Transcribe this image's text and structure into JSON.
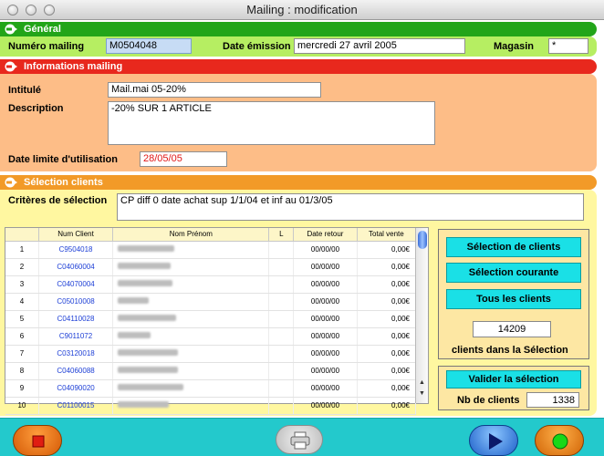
{
  "window": {
    "title": "Mailing : modification"
  },
  "general": {
    "header": "Général",
    "numero_label": "Numéro mailing",
    "numero_value": "M0504048",
    "date_label": "Date émission",
    "date_value": "mercredi 27 avril 2005",
    "magasin_label": "Magasin",
    "magasin_value": "*"
  },
  "info": {
    "header": "Informations mailing",
    "intitule_label": "Intitulé",
    "intitule_value": "Mail.mai 05-20%",
    "description_label": "Description",
    "description_value": "-20% SUR 1 ARTICLE",
    "date_limite_label": "Date limite d'utilisation",
    "date_limite_value": "28/05/05"
  },
  "selection": {
    "header": "Sélection clients",
    "criteres_label": "Critères de sélection",
    "criteres_value": "CP diff 0   date achat sup 1/1/04 et inf au 01/3/05"
  },
  "table": {
    "columns": [
      "",
      "Num Client",
      "Nom Prénom",
      "L",
      "Date retour",
      "Total vente"
    ],
    "rows": [
      {
        "n": "1",
        "client": "C9504018",
        "name_len": 62,
        "date": "00/00/00",
        "total": "0,00€"
      },
      {
        "n": "2",
        "client": "C04060004",
        "name_len": 58,
        "date": "00/00/00",
        "total": "0,00€"
      },
      {
        "n": "3",
        "client": "C04070004",
        "name_len": 60,
        "date": "00/00/00",
        "total": "0,00€"
      },
      {
        "n": "4",
        "client": "C05010008",
        "name_len": 34,
        "date": "00/00/00",
        "total": "0,00€"
      },
      {
        "n": "5",
        "client": "C04110028",
        "name_len": 64,
        "date": "00/00/00",
        "total": "0,00€"
      },
      {
        "n": "6",
        "client": "C9011072",
        "name_len": 36,
        "date": "00/00/00",
        "total": "0,00€"
      },
      {
        "n": "7",
        "client": "C03120018",
        "name_len": 66,
        "date": "00/00/00",
        "total": "0,00€"
      },
      {
        "n": "8",
        "client": "C04060088",
        "name_len": 66,
        "date": "00/00/00",
        "total": "0,00€"
      },
      {
        "n": "9",
        "client": "C04090020",
        "name_len": 72,
        "date": "00/00/00",
        "total": "0,00€"
      },
      {
        "n": "10",
        "client": "C01100015",
        "name_len": 56,
        "date": "00/00/00",
        "total": "0,00€"
      }
    ]
  },
  "actions": {
    "selection_clients": "Sélection de clients",
    "selection_courante": "Sélection courante",
    "tous_clients": "Tous les clients",
    "count": "14209",
    "count_caption": "clients dans la Sélection",
    "valider": "Valider la sélection",
    "nb_label": "Nb de clients",
    "nb_value": "1338"
  },
  "icons": {
    "stop": "stop-icon",
    "print": "printer-icon",
    "next": "play-icon",
    "validate": "green-light-icon"
  }
}
